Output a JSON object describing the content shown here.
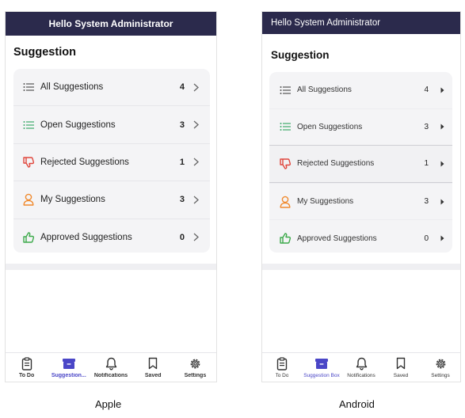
{
  "apple": {
    "header_title": "Hello System Administrator",
    "section_title": "Suggestion",
    "rows": [
      {
        "label": "All Suggestions",
        "count": "4",
        "icon": "list-icon"
      },
      {
        "label": "Open Suggestions",
        "count": "3",
        "icon": "list-icon"
      },
      {
        "label": "Rejected Suggestions",
        "count": "1",
        "icon": "thumbs-down-icon"
      },
      {
        "label": "My Suggestions",
        "count": "3",
        "icon": "person-icon"
      },
      {
        "label": "Approved Suggestions",
        "count": "0",
        "icon": "thumbs-up-icon"
      }
    ],
    "tabs": [
      {
        "label": "To Do",
        "icon": "clipboard-icon"
      },
      {
        "label": "Suggestion...",
        "icon": "suggestion-box-icon"
      },
      {
        "label": "Notifications",
        "icon": "bell-icon"
      },
      {
        "label": "Saved",
        "icon": "bookmark-icon"
      },
      {
        "label": "Settings",
        "icon": "gear-icon"
      }
    ]
  },
  "android": {
    "header_title": "Hello System Administrator",
    "section_title": "Suggestion",
    "rows": [
      {
        "label": "All Suggestions",
        "count": "4",
        "icon": "list-icon"
      },
      {
        "label": "Open Suggestions",
        "count": "3",
        "icon": "list-icon"
      },
      {
        "label": "Rejected Suggestions",
        "count": "1",
        "icon": "thumbs-down-icon"
      },
      {
        "label": "My Suggestions",
        "count": "3",
        "icon": "person-icon"
      },
      {
        "label": "Approved Suggestions",
        "count": "0",
        "icon": "thumbs-up-icon"
      }
    ],
    "tabs": [
      {
        "label": "To Do",
        "icon": "clipboard-icon"
      },
      {
        "label": "Suggestion Box",
        "icon": "suggestion-box-icon"
      },
      {
        "label": "Notifications",
        "icon": "bell-icon"
      },
      {
        "label": "Saved",
        "icon": "bookmark-icon"
      },
      {
        "label": "Settings",
        "icon": "gear-icon"
      }
    ]
  },
  "captions": {
    "apple": "Apple",
    "android": "Android"
  },
  "colors": {
    "header_bg": "#2b2a4c",
    "list_gray": "#555555",
    "open_green": "#3daa6b",
    "rejected_red": "#e0463c",
    "person_orange": "#f08a2e",
    "approved_green": "#3daa4b",
    "active_tab": "#4a46c7"
  }
}
